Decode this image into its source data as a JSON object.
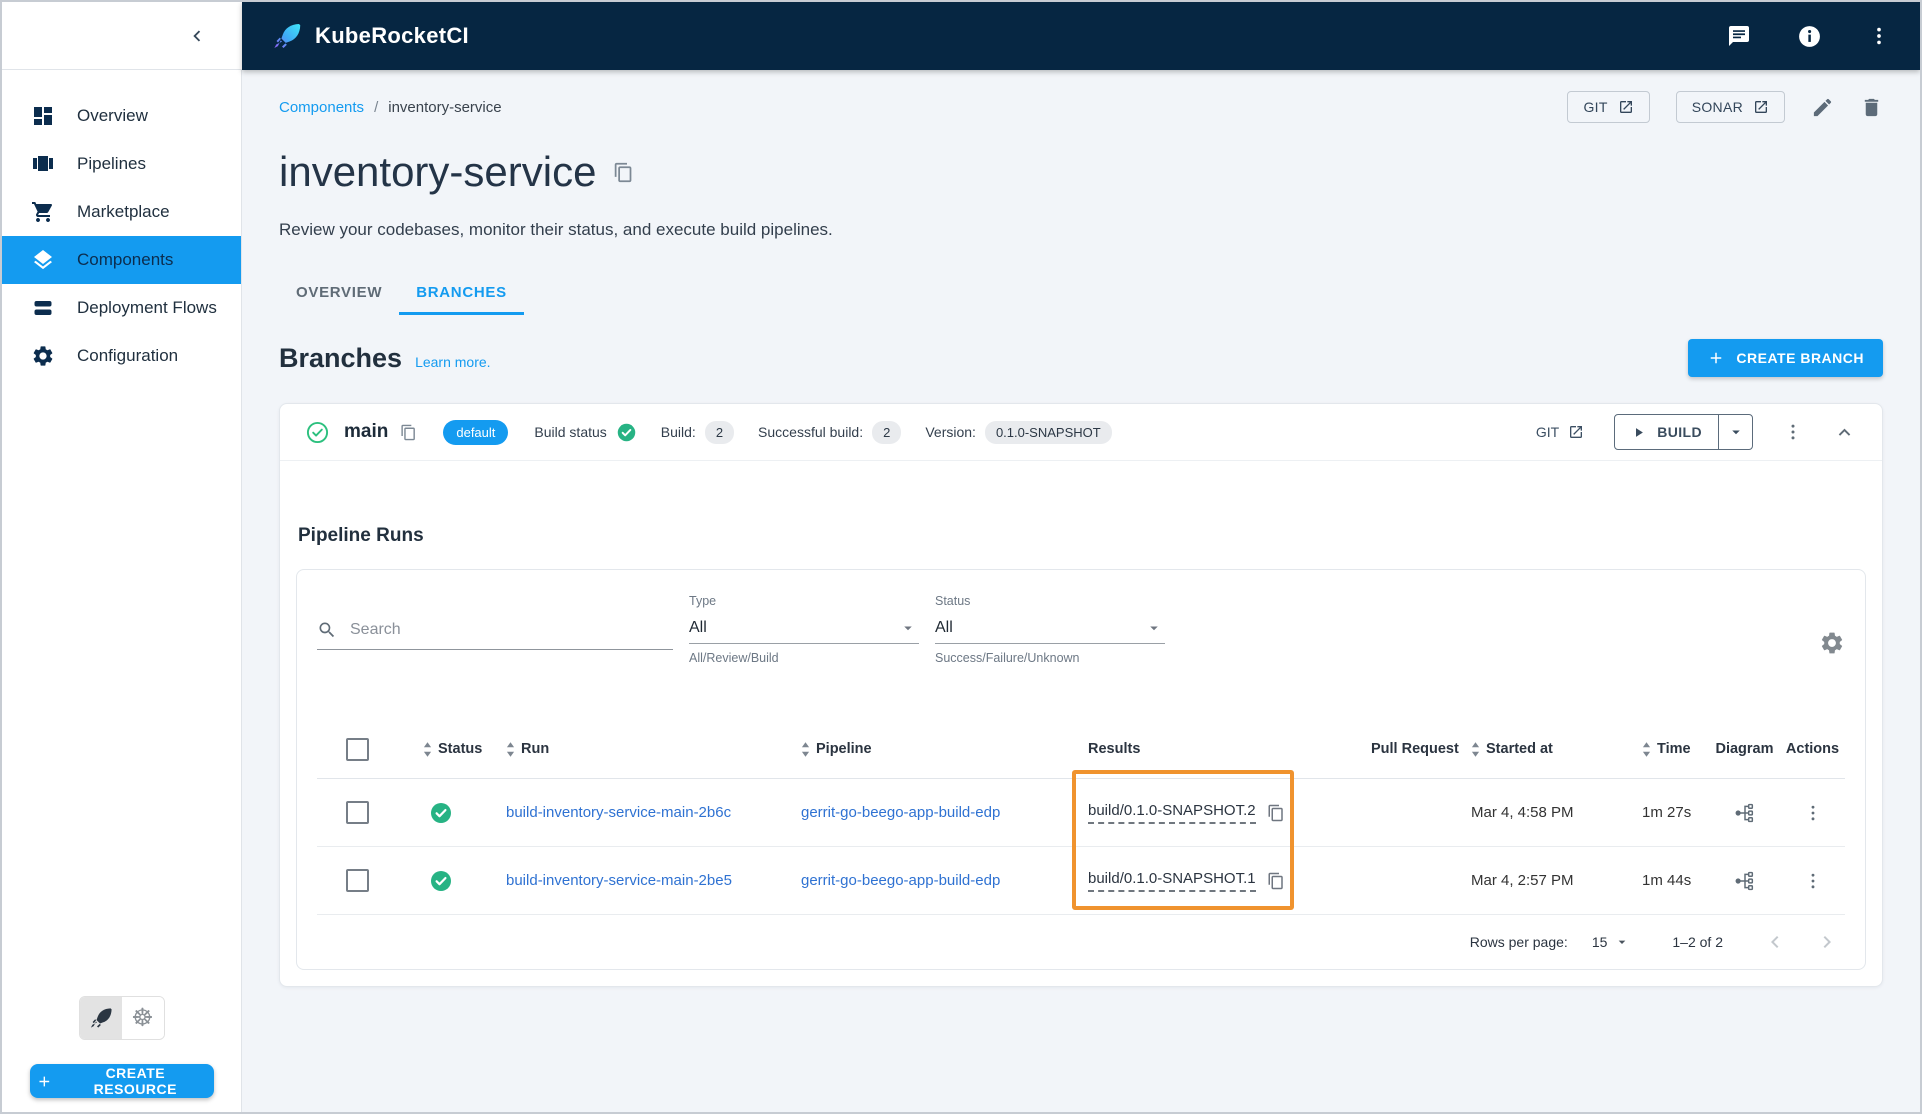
{
  "header": {
    "brand": "KubeRocketCI"
  },
  "sidebar": {
    "items": [
      {
        "label": "Overview"
      },
      {
        "label": "Pipelines"
      },
      {
        "label": "Marketplace"
      },
      {
        "label": "Components"
      },
      {
        "label": "Deployment Flows"
      },
      {
        "label": "Configuration"
      }
    ],
    "create_resource_label": "CREATE RESOURCE"
  },
  "breadcrumb": {
    "parent": "Components",
    "separator": "/",
    "current": "inventory-service"
  },
  "toolbar": {
    "git_label": "GIT",
    "sonar_label": "SONAR"
  },
  "page": {
    "title": "inventory-service",
    "description": "Review your codebases, monitor their status, and execute build pipelines."
  },
  "tabs": [
    {
      "label": "OVERVIEW"
    },
    {
      "label": "BRANCHES"
    }
  ],
  "branches_section": {
    "heading": "Branches",
    "learn_more": "Learn more.",
    "create_branch_label": "CREATE BRANCH"
  },
  "branch": {
    "name": "main",
    "badge": "default",
    "build_status_label": "Build status",
    "build_label": "Build:",
    "build_count": "2",
    "successful_build_label": "Successful build:",
    "successful_build_count": "2",
    "version_label": "Version:",
    "version": "0.1.0-SNAPSHOT",
    "git_label": "GIT",
    "build_button_label": "BUILD"
  },
  "pipeline_runs": {
    "heading": "Pipeline Runs",
    "search_placeholder": "Search",
    "type_label": "Type",
    "type_value": "All",
    "type_helper": "All/Review/Build",
    "status_label": "Status",
    "status_value": "All",
    "status_helper": "Success/Failure/Unknown"
  },
  "table": {
    "columns": {
      "status": "Status",
      "run": "Run",
      "pipeline": "Pipeline",
      "results": "Results",
      "pull_request": "Pull Request",
      "started_at": "Started at",
      "time": "Time",
      "diagram": "Diagram",
      "actions": "Actions"
    },
    "rows": [
      {
        "run": "build-inventory-service-main-2b6c",
        "pipeline": "gerrit-go-beego-app-build-edp",
        "result": "build/0.1.0-SNAPSHOT.2",
        "started_at": "Mar 4, 4:58 PM",
        "time": "1m 27s"
      },
      {
        "run": "build-inventory-service-main-2be5",
        "pipeline": "gerrit-go-beego-app-build-edp",
        "result": "build/0.1.0-SNAPSHOT.1",
        "started_at": "Mar 4, 2:57 PM",
        "time": "1m 44s"
      }
    ]
  },
  "pagination": {
    "rows_per_page_label": "Rows per page:",
    "rows_per_page_value": "15",
    "range": "1–2 of 2"
  },
  "colors": {
    "header_navy": "#062642",
    "accent_blue": "#149bf0",
    "link_blue": "#2f72d2",
    "success_green": "#27b384",
    "annotation_orange": "#f0932e"
  }
}
